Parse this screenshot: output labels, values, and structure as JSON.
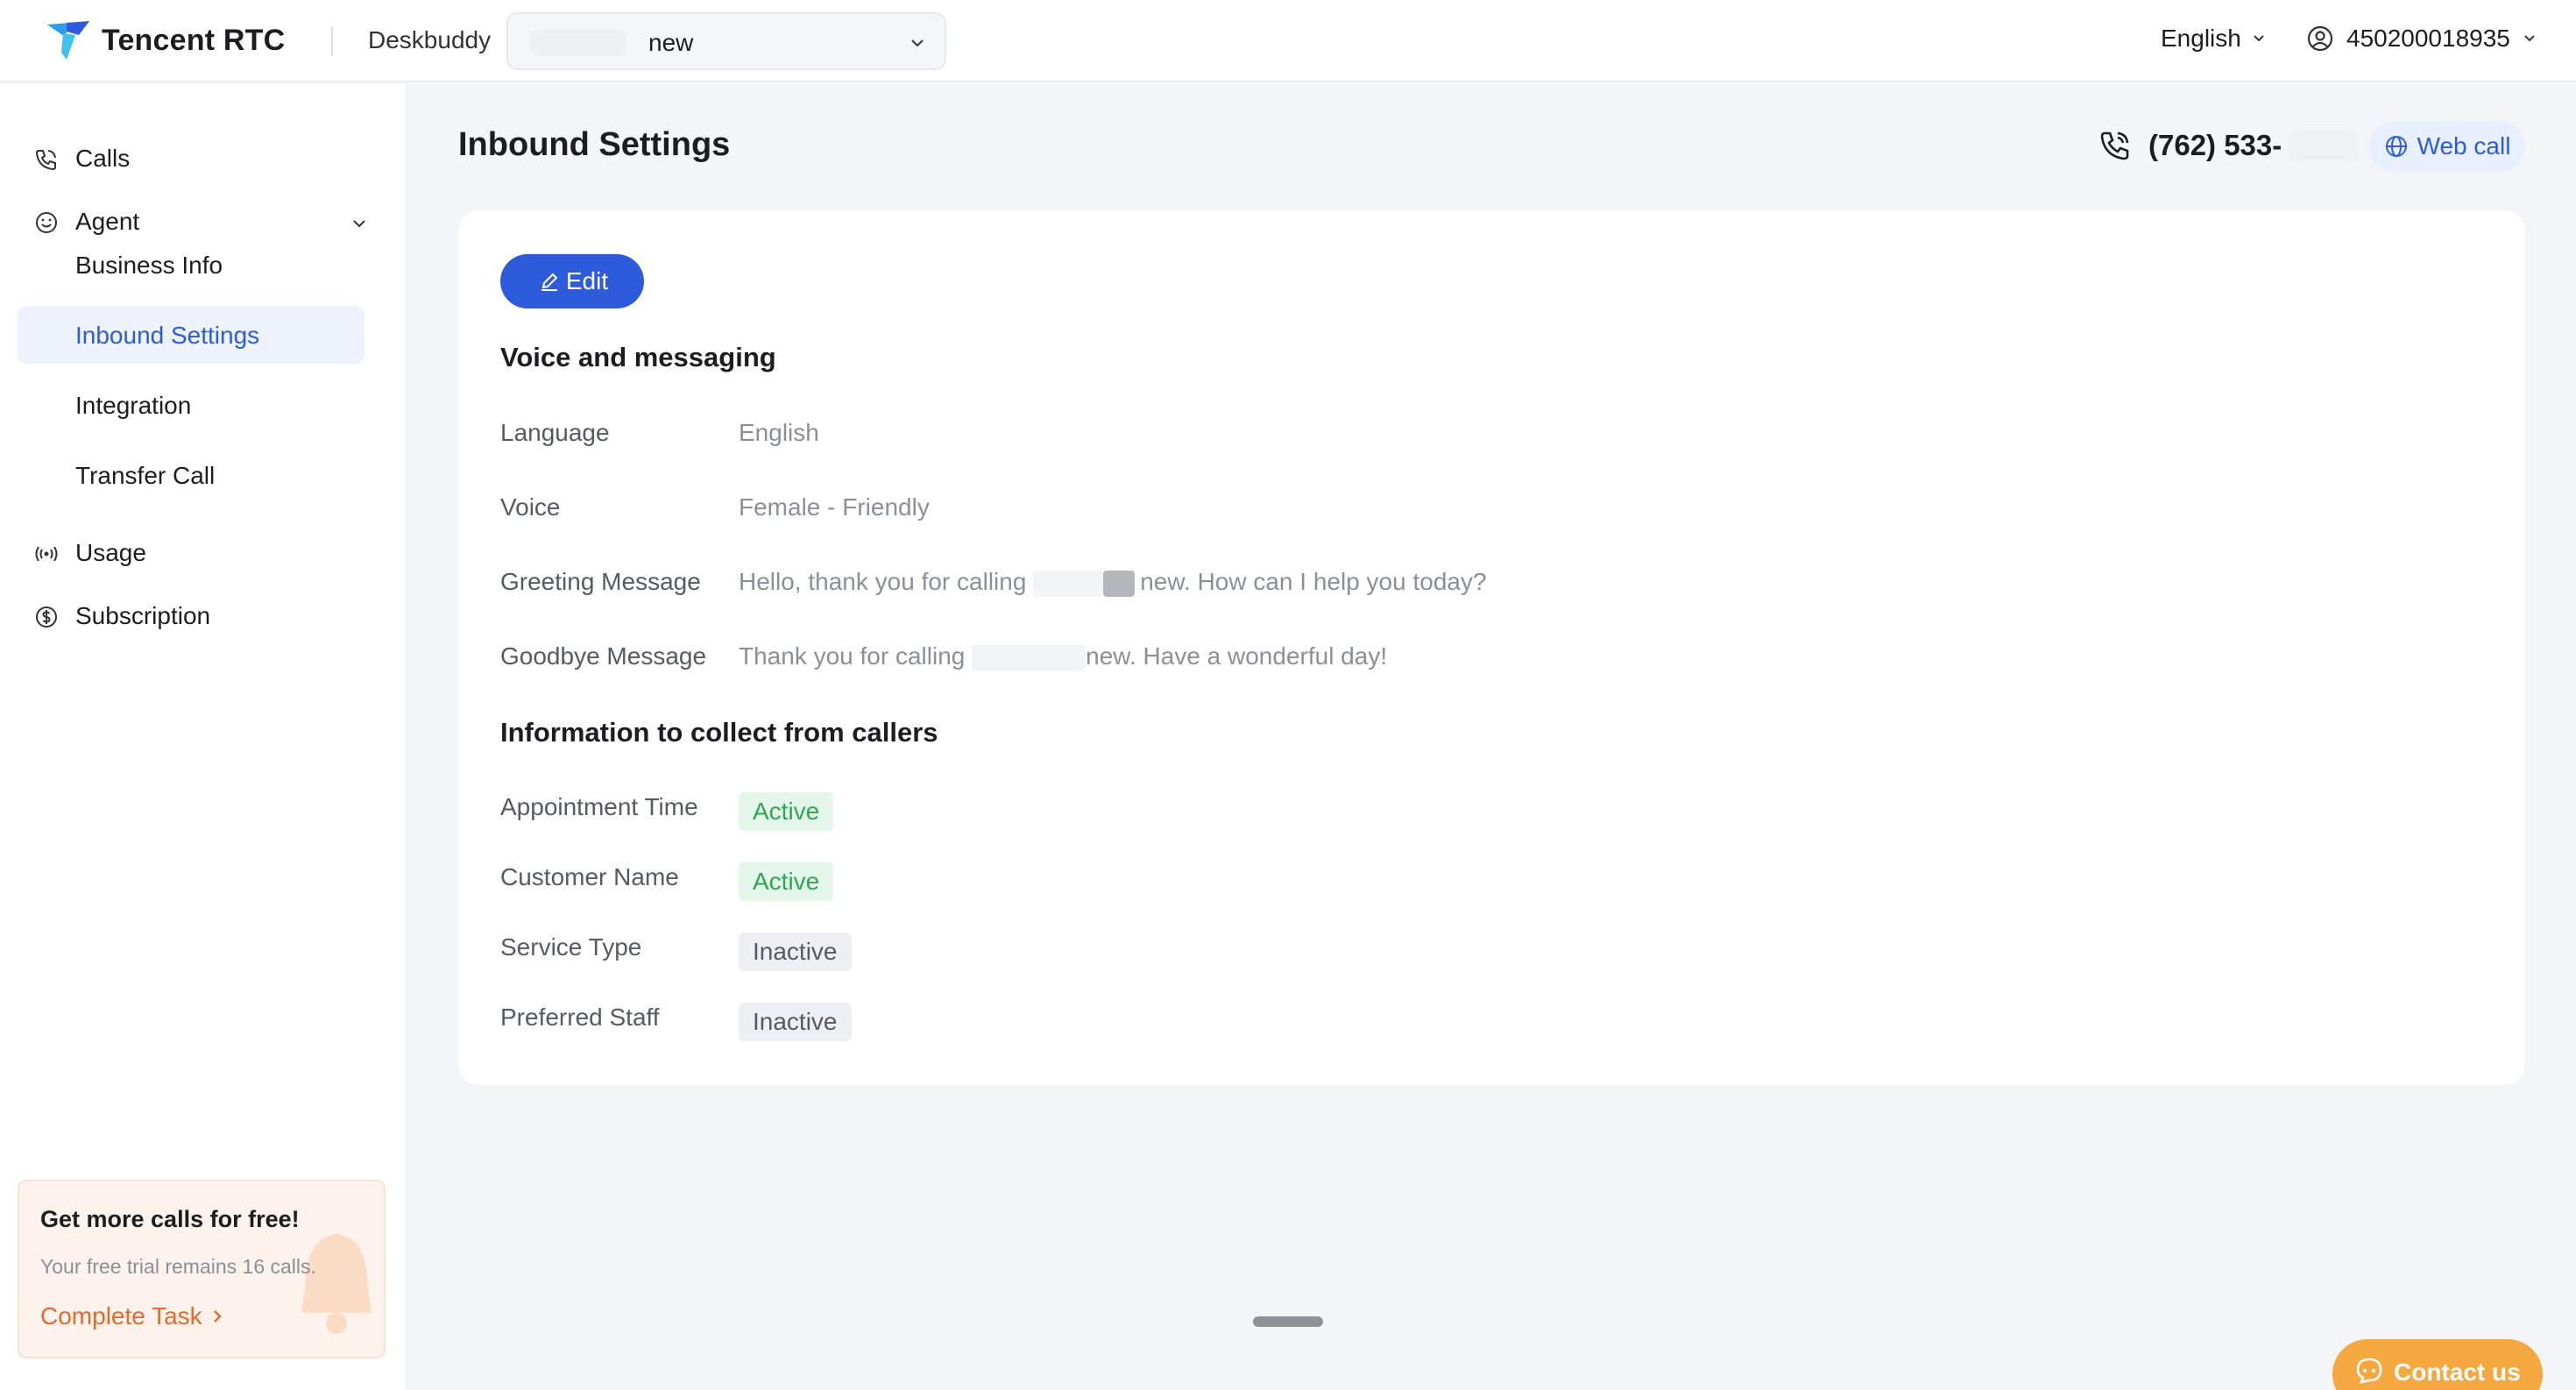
{
  "header": {
    "brand_name": "Tencent RTC",
    "product_name": "Deskbuddy",
    "org_select_value": "new",
    "language": "English",
    "account_id": "450200018935"
  },
  "sidebar": {
    "items": [
      {
        "label": "Calls",
        "icon": "phone-icon"
      },
      {
        "label": "Agent",
        "icon": "smile-icon"
      },
      {
        "label": "Usage",
        "icon": "broadcast-icon"
      },
      {
        "label": "Subscription",
        "icon": "dollar-circle-icon"
      }
    ],
    "sub_items": [
      {
        "label": "Business Info"
      },
      {
        "label": "Inbound Settings",
        "active": true
      },
      {
        "label": "Integration"
      },
      {
        "label": "Transfer Call"
      }
    ],
    "promo": {
      "title": "Get more calls for free!",
      "subtitle": "Your free trial remains 16 calls.",
      "link": "Complete Task"
    }
  },
  "main": {
    "page_title": "Inbound Settings",
    "phone_number": "(762) 533-",
    "web_call_label": "Web call",
    "edit_label": "Edit",
    "voice_section": {
      "title": "Voice and messaging",
      "fields": [
        {
          "label": "Language",
          "value": "English"
        },
        {
          "label": "Voice",
          "value": "Female - Friendly"
        },
        {
          "label": "Greeting Message",
          "value_prefix": "Hello, thank you for calling ",
          "value_suffix": "new. How can I help you today?"
        },
        {
          "label": "Goodbye Message",
          "value_prefix": "Thank you for calling ",
          "value_suffix": "new. Have a wonderful day!"
        }
      ]
    },
    "collect_section": {
      "title": "Information to collect from callers",
      "fields": [
        {
          "label": "Appointment Time",
          "status": "Active"
        },
        {
          "label": "Customer Name",
          "status": "Active"
        },
        {
          "label": "Service Type",
          "status": "Inactive"
        },
        {
          "label": "Preferred Staff",
          "status": "Inactive"
        }
      ]
    }
  },
  "contact_label": "Contact us",
  "colors": {
    "accent": "#2d5bdb",
    "active_bg": "#e4f7ea",
    "active_text": "#2fa653",
    "promo_link": "#e26a2c",
    "contact_bg": "#f4a83f"
  }
}
